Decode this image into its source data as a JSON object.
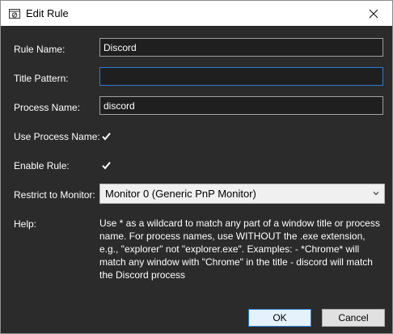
{
  "window": {
    "title": "Edit Rule",
    "icon": "window-rule-icon",
    "close_icon": "close-icon"
  },
  "form": {
    "rule_name": {
      "label": "Rule Name:",
      "value": "Discord"
    },
    "title_pattern": {
      "label": "Title Pattern:",
      "value": ""
    },
    "process_name": {
      "label": "Process Name:",
      "value": "discord"
    },
    "use_process_name": {
      "label": "Use Process Name:",
      "checked": true
    },
    "enable_rule": {
      "label": "Enable Rule:",
      "checked": true
    },
    "restrict_monitor": {
      "label": "Restrict to Monitor:",
      "selected": "Monitor 0 (Generic PnP Monitor)"
    },
    "help": {
      "label": "Help:",
      "text": "Use * as a wildcard to match any part of a window title or process name. For process names, use WITHOUT the .exe extension, e.g., \"explorer\" not \"explorer.exe\". Examples: - *Chrome* will match any window with \"Chrome\" in the title - discord will match the Discord process"
    }
  },
  "buttons": {
    "ok": "OK",
    "cancel": "Cancel"
  },
  "colors": {
    "background": "#2b2b2b",
    "focus_border": "#2d7ad6",
    "text": "#ffffff"
  }
}
